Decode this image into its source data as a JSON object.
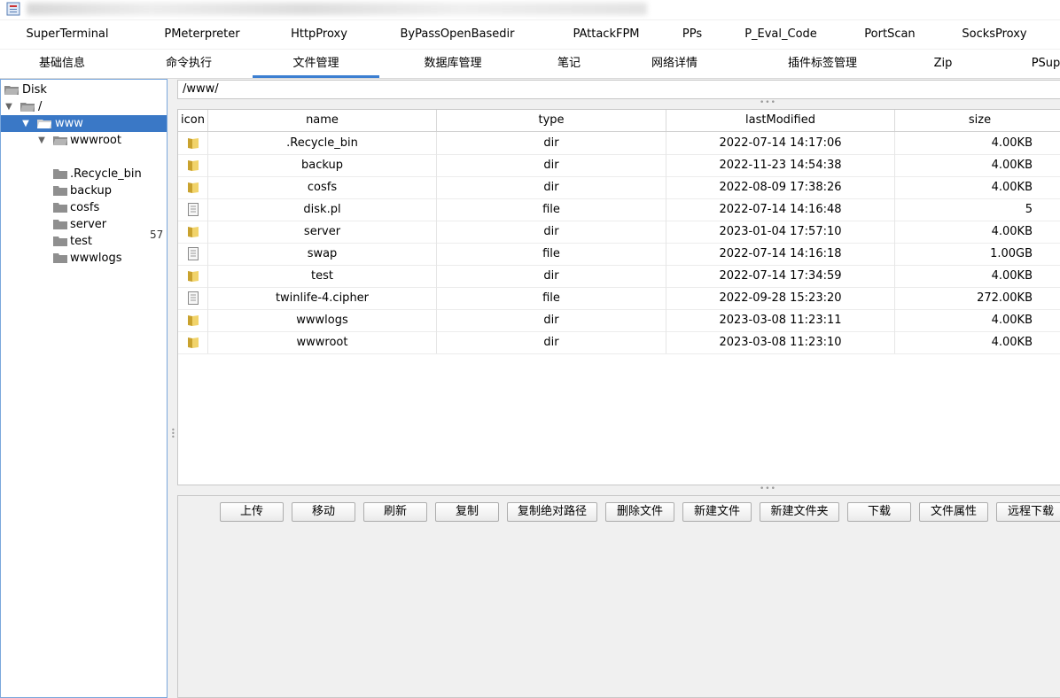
{
  "tabs_row1": [
    "SuperTerminal",
    "PMeterpreter",
    "HttpProxy",
    "ByPassOpenBasedir",
    "PAttackFPM",
    "PPs",
    "P_Eval_Code",
    "PortScan",
    "SocksProxy"
  ],
  "tabs_row2": [
    "基础信息",
    "命令执行",
    "文件管理",
    "数据库管理",
    "笔记",
    "网络详情",
    "插件标签管理",
    "Zip",
    "PSup"
  ],
  "active_tab": "文件管理",
  "tree": {
    "root": "Disk",
    "slash": "/",
    "www": "www",
    "wwwroot": "wwwroot",
    "hidden_suffix": "57",
    "children": [
      ".Recycle_bin",
      "backup",
      "cosfs",
      "server",
      "test",
      "wwwlogs"
    ]
  },
  "path": "/www/",
  "table": {
    "headers": [
      "icon",
      "name",
      "type",
      "lastModified",
      "size"
    ],
    "rows": [
      {
        "name": ".Recycle_bin",
        "type": "dir",
        "lastModified": "2022-07-14 14:17:06",
        "size": "4.00KB"
      },
      {
        "name": "backup",
        "type": "dir",
        "lastModified": "2022-11-23 14:54:38",
        "size": "4.00KB"
      },
      {
        "name": "cosfs",
        "type": "dir",
        "lastModified": "2022-08-09 17:38:26",
        "size": "4.00KB"
      },
      {
        "name": "disk.pl",
        "type": "file",
        "lastModified": "2022-07-14 14:16:48",
        "size": "5"
      },
      {
        "name": "server",
        "type": "dir",
        "lastModified": "2023-01-04 17:57:10",
        "size": "4.00KB"
      },
      {
        "name": "swap",
        "type": "file",
        "lastModified": "2022-07-14 14:16:18",
        "size": "1.00GB"
      },
      {
        "name": "test",
        "type": "dir",
        "lastModified": "2022-07-14 17:34:59",
        "size": "4.00KB"
      },
      {
        "name": "twinlife-4.cipher",
        "type": "file",
        "lastModified": "2022-09-28 15:23:20",
        "size": "272.00KB"
      },
      {
        "name": "wwwlogs",
        "type": "dir",
        "lastModified": "2023-03-08 11:23:11",
        "size": "4.00KB"
      },
      {
        "name": "wwwroot",
        "type": "dir",
        "lastModified": "2023-03-08 11:23:10",
        "size": "4.00KB"
      }
    ]
  },
  "buttons": [
    "上传",
    "移动",
    "刷新",
    "复制",
    "复制绝对路径",
    "删除文件",
    "新建文件",
    "新建文件夹",
    "下载",
    "文件属性",
    "远程下载"
  ],
  "colors": {
    "selection": "#3a78c6",
    "tab_underline": "#3c7fd1",
    "folder": "#e8c24a"
  },
  "icons": {
    "dir": "folder-icon",
    "file": "file-icon"
  }
}
